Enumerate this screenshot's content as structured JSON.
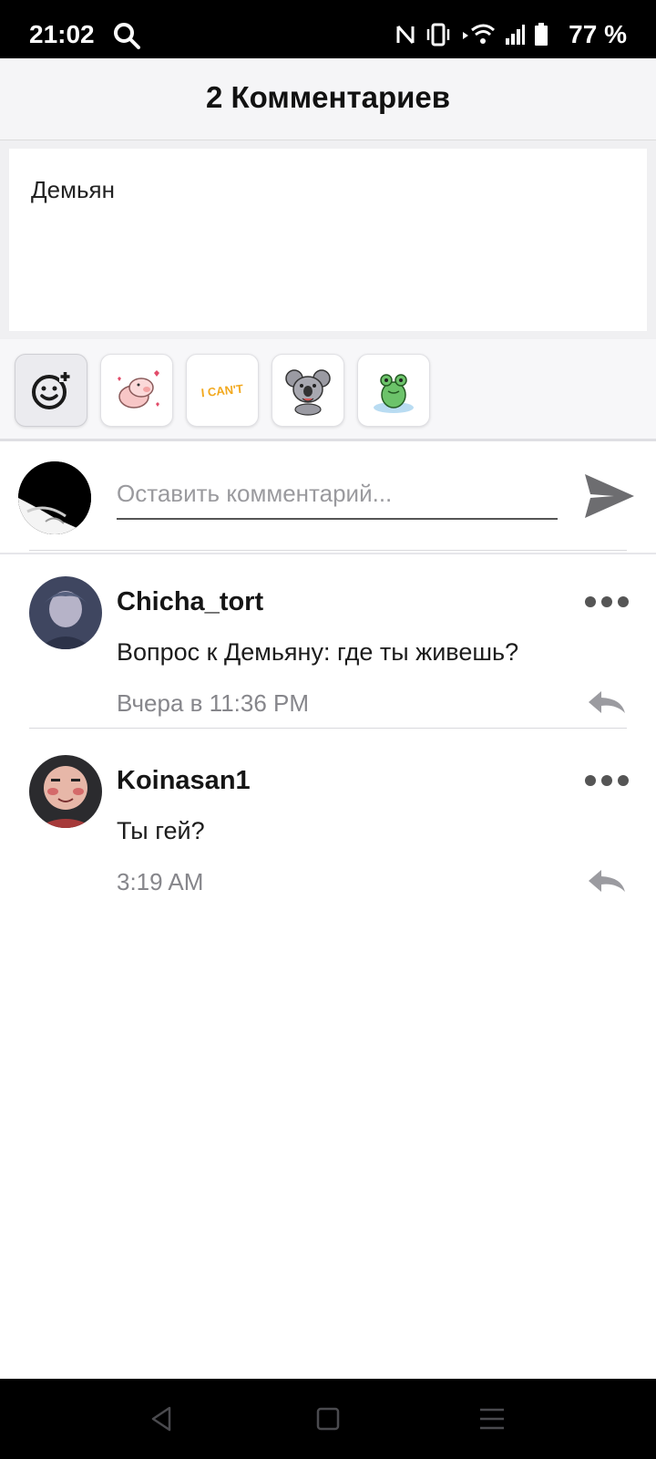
{
  "status_bar": {
    "time": "21:02",
    "battery_text": "77 %",
    "icons": [
      "search-icon",
      "nfc-icon",
      "vibrate-icon",
      "wifi-icon",
      "signal-icon",
      "battery-icon"
    ]
  },
  "header": {
    "title": "2 Комментариев"
  },
  "post": {
    "text": "Демьян"
  },
  "stickers": {
    "add_icon": "add-sticker-icon",
    "items": [
      {
        "icon": "pig-sticker-icon"
      },
      {
        "icon": "i-cant-sticker-icon",
        "text": "I CAN'T"
      },
      {
        "icon": "koala-sticker-icon"
      },
      {
        "icon": "frog-sticker-icon"
      }
    ]
  },
  "compose": {
    "placeholder": "Оставить комментарий...",
    "send_icon": "send-icon"
  },
  "comments": [
    {
      "username": "Chicha_tort",
      "text": "Вопрос к Демьяну: где ты живешь?",
      "time": "Вчера в 11:36 PM"
    },
    {
      "username": "Koinasan1",
      "text": "Ты гей?",
      "time": "3:19 AM"
    }
  ],
  "colors": {
    "header_bg": "#f5f5f7",
    "accent_dark": "#555555",
    "muted_text": "#86868b"
  }
}
